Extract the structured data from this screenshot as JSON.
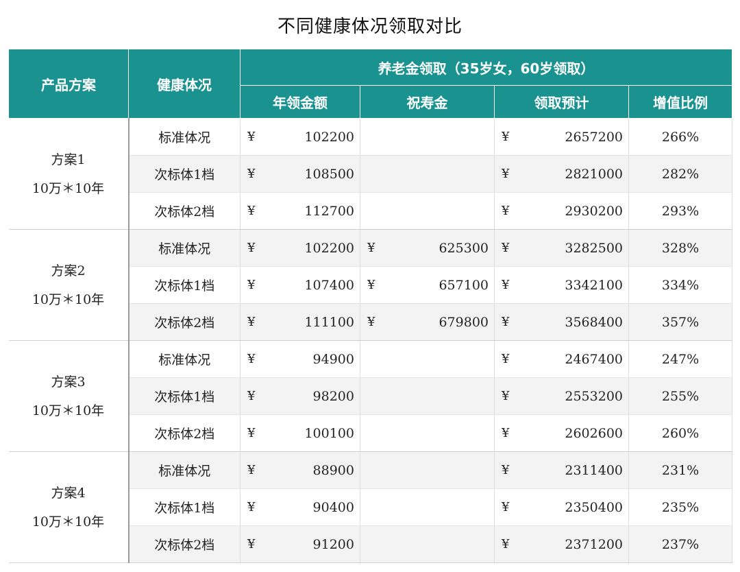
{
  "title": "不同健康体况领取对比",
  "header": {
    "col_plan": "产品方案",
    "col_health": "健康体况",
    "group": "养老金领取（35岁女，60岁领取）",
    "annual": "年领金额",
    "birthday": "祝寿金",
    "total": "领取预计",
    "ratio": "增值比例"
  },
  "currency": "¥",
  "plans": [
    {
      "name": "方案1",
      "term": "10万＊10年",
      "rows": [
        {
          "health": "标准体况",
          "annual": "102200",
          "birthday": "",
          "total": "2657200",
          "ratio": "266%"
        },
        {
          "health": "次标体1档",
          "annual": "108500",
          "birthday": "",
          "total": "2821000",
          "ratio": "282%"
        },
        {
          "health": "次标体2档",
          "annual": "112700",
          "birthday": "",
          "total": "2930200",
          "ratio": "293%"
        }
      ]
    },
    {
      "name": "方案2",
      "term": "10万＊10年",
      "rows": [
        {
          "health": "标准体况",
          "annual": "102200",
          "birthday": "625300",
          "total": "3282500",
          "ratio": "328%"
        },
        {
          "health": "次标体1档",
          "annual": "107400",
          "birthday": "657100",
          "total": "3342100",
          "ratio": "334%"
        },
        {
          "health": "次标体2档",
          "annual": "111100",
          "birthday": "679800",
          "total": "3568400",
          "ratio": "357%"
        }
      ]
    },
    {
      "name": "方案3",
      "term": "10万＊10年",
      "rows": [
        {
          "health": "标准体况",
          "annual": "94900",
          "birthday": "",
          "total": "2467400",
          "ratio": "247%"
        },
        {
          "health": "次标体1档",
          "annual": "98200",
          "birthday": "",
          "total": "2553200",
          "ratio": "255%"
        },
        {
          "health": "次标体2档",
          "annual": "100100",
          "birthday": "",
          "total": "2602600",
          "ratio": "260%"
        }
      ]
    },
    {
      "name": "方案4",
      "term": "10万＊10年",
      "rows": [
        {
          "health": "标准体况",
          "annual": "88900",
          "birthday": "",
          "total": "2311400",
          "ratio": "231%"
        },
        {
          "health": "次标体1档",
          "annual": "90400",
          "birthday": "",
          "total": "2350400",
          "ratio": "235%"
        },
        {
          "health": "次标体2档",
          "annual": "91200",
          "birthday": "",
          "total": "2371200",
          "ratio": "237%"
        }
      ]
    }
  ],
  "colors": {
    "header_bg": "#1a9390",
    "row_alt": "#f3f3f3"
  }
}
